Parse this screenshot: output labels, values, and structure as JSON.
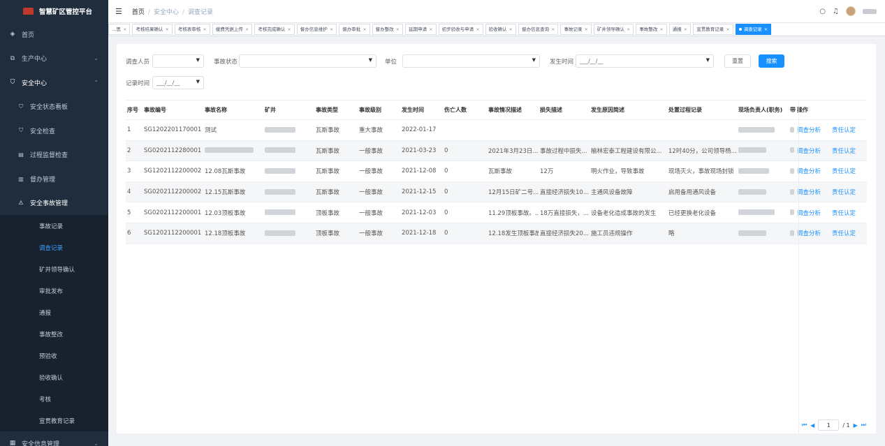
{
  "app": {
    "title": "智慧矿区管控平台"
  },
  "sidebar": {
    "items": [
      {
        "label": "首页",
        "icon": "dashboard-icon"
      },
      {
        "label": "生产中心",
        "icon": "layers-icon"
      },
      {
        "label": "安全中心",
        "icon": "shield-icon"
      }
    ],
    "safety_subs": [
      {
        "label": "安全状态看板",
        "icon": "shield-icon"
      },
      {
        "label": "安全检查",
        "icon": "shield-icon"
      },
      {
        "label": "过程监督检查",
        "icon": "clipboard-icon"
      },
      {
        "label": "督办管理",
        "icon": "document-icon"
      },
      {
        "label": "安全事故管理",
        "icon": "warning-icon"
      }
    ],
    "accident_items": [
      "事故记录",
      "调查记录",
      "矿井领导确认",
      "审批发布",
      "通报",
      "事故整改",
      "预验收",
      "验收确认",
      "考核",
      "宣贯教育记录"
    ],
    "bottom_item": {
      "label": "安全信息管理",
      "icon": "grid-icon"
    }
  },
  "header": {
    "breadcrumb": [
      "首页",
      "安全中心",
      "调查记录"
    ]
  },
  "tags": [
    "…思",
    "考核结果确认",
    "考核表审核",
    "缓费凭据上传",
    "考核完成确认",
    "督办信息维护",
    "督办审批",
    "督办整改",
    "延期申请",
    "初步验收与申请",
    "验收确认",
    "督办信息查询",
    "事故记录",
    "矿井领导确认",
    "事故整改",
    "通报",
    "宣贯教育记录",
    "调查记录"
  ],
  "filters": {
    "investigator_label": "调查人员",
    "status_label": "事故状态",
    "unit_label": "单位",
    "occur_time_label": "发生时间",
    "occur_time_value": "___/__/__",
    "record_time_label": "记录时间",
    "record_time_value": "___/__/__",
    "reset_label": "重置",
    "search_label": "搜索"
  },
  "table": {
    "columns": [
      "序号",
      "事故编号",
      "事故名称",
      "矿井",
      "事故类型",
      "事故级别",
      "发生时间",
      "伤亡人数",
      "事故情况描述",
      "损失描述",
      "发生原因简述",
      "处置过程记录",
      "现场负责人(职务)",
      "带",
      "操作"
    ],
    "rows": [
      {
        "no": "1",
        "code": "SG1202201170001",
        "name": "测试",
        "type": "瓦斯事故",
        "level": "重大事故",
        "time": "2022-01-17",
        "casualty": "",
        "desc": "",
        "loss": "",
        "cause": "",
        "process": ""
      },
      {
        "no": "2",
        "code": "SG0202112280001",
        "name": "",
        "type": "瓦斯事故",
        "level": "一般事故",
        "time": "2021-03-23",
        "casualty": "0",
        "desc": "2021年3月23日...",
        "loss": "事故过程中损失...",
        "cause": "榆林宏泰工程建设有限公...",
        "process": "12时40分，公司领导杨..."
      },
      {
        "no": "3",
        "code": "SG1202112200002",
        "name": "12.08瓦斯事故",
        "type": "瓦斯事故",
        "level": "一般事故",
        "time": "2021-12-08",
        "casualty": "0",
        "desc": "瓦斯事故",
        "loss": "12万",
        "cause": "明火作业，导致事故",
        "process": "现场灭火，事故现场封锁"
      },
      {
        "no": "4",
        "code": "SG0202112200002",
        "name": "12.15瓦斯事故",
        "type": "瓦斯事故",
        "level": "一般事故",
        "time": "2021-12-15",
        "casualty": "0",
        "desc": "12月15日矿二号...",
        "loss": "直接经济损失10...",
        "cause": "主通风设备故障",
        "process": "启用备用通风设备"
      },
      {
        "no": "5",
        "code": "SG0202112200001",
        "name": "12.03顶板事故",
        "type": "顶板事故",
        "level": "一般事故",
        "time": "2021-12-03",
        "casualty": "0",
        "desc": "11.29顶板事故。...",
        "loss": "18万直接损失，...",
        "cause": "设备老化造成事故的发生",
        "process": "已经更换老化设备"
      },
      {
        "no": "6",
        "code": "SG1202112200001",
        "name": "12.18顶板事故",
        "type": "顶板事故",
        "level": "一般事故",
        "time": "2021-12-18",
        "casualty": "0",
        "desc": "12.18发生顶板事故",
        "loss": "直接经济损失20...",
        "cause": "施工员违规操作",
        "process": "略"
      }
    ],
    "action_analyze": "调查分析",
    "action_confirm": "责任认定"
  },
  "pager": {
    "page": "1",
    "total": "/ 1"
  }
}
